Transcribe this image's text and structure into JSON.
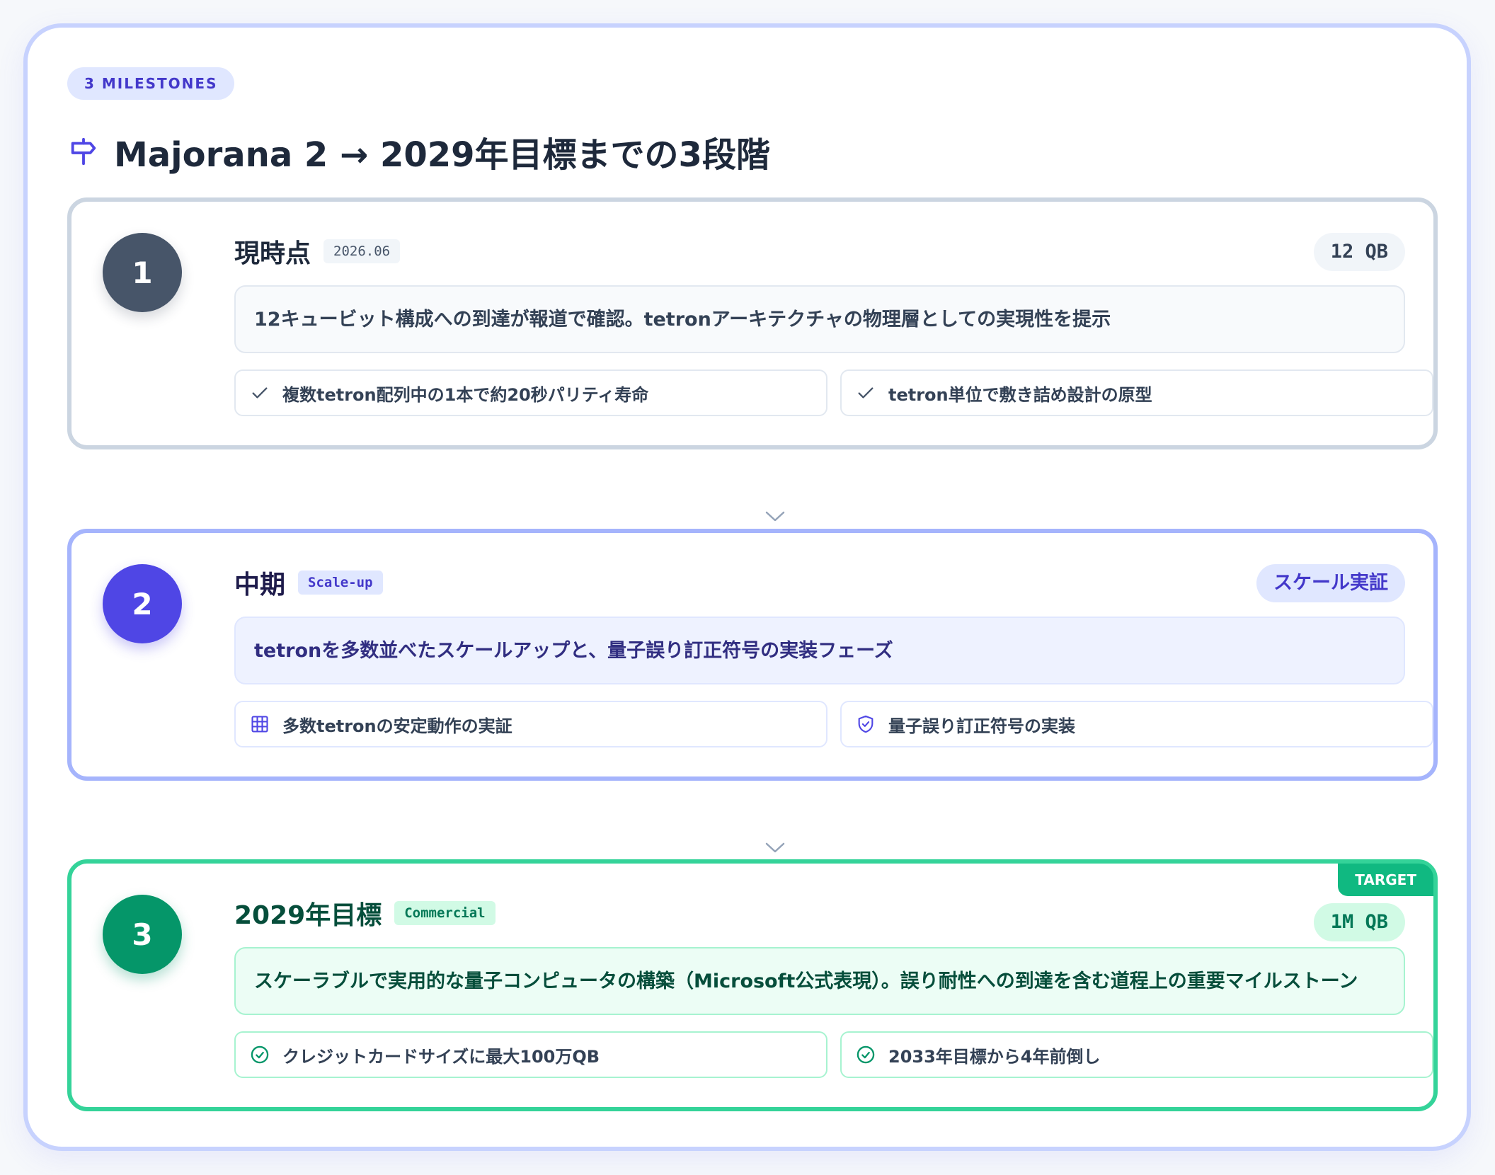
{
  "header": {
    "milestones_pill": "3 MILESTONES",
    "title": "Majorana 2 → 2029年目標までの3段階",
    "title_icon": "signpost-icon"
  },
  "colors": {
    "stage1": "#475569",
    "stage2": "#4f46e5",
    "stage3": "#059669",
    "accent_border": "#c7d2fe"
  },
  "milestones": [
    {
      "number": "1",
      "stage": "現時点",
      "tag": "2026.06",
      "badge": "12 QB",
      "description": "12キュービット構成への到達が報道で確認。tetronアーキテクチャの物理層としての実現性を提示",
      "features": [
        {
          "icon": "check-icon",
          "text": "複数tetron配列中の1本で約20秒パリティ寿命"
        },
        {
          "icon": "check-icon",
          "text": "tetron単位で敷き詰め設計の原型"
        }
      ]
    },
    {
      "number": "2",
      "stage": "中期",
      "tag": "Scale-up",
      "badge": "スケール実証",
      "description": "tetronを多数並べたスケールアップと、量子誤り訂正符号の実装フェーズ",
      "features": [
        {
          "icon": "grid-icon",
          "text": "多数tetronの安定動作の実証"
        },
        {
          "icon": "shield-check-icon",
          "text": "量子誤り訂正符号の実装"
        }
      ]
    },
    {
      "number": "3",
      "stage": "2029年目標",
      "tag": "Commercial",
      "badge": "1M QB",
      "corner_label": "TARGET",
      "description": "スケーラブルで実用的な量子コンピュータの構築（Microsoft公式表現）。誤り耐性への到達を含む道程上の重要マイルストーン",
      "features": [
        {
          "icon": "check-circle-icon",
          "text": "クレジットカードサイズに最大100万QB"
        },
        {
          "icon": "check-circle-icon",
          "text": "2033年目標から4年前倒し"
        }
      ]
    }
  ]
}
